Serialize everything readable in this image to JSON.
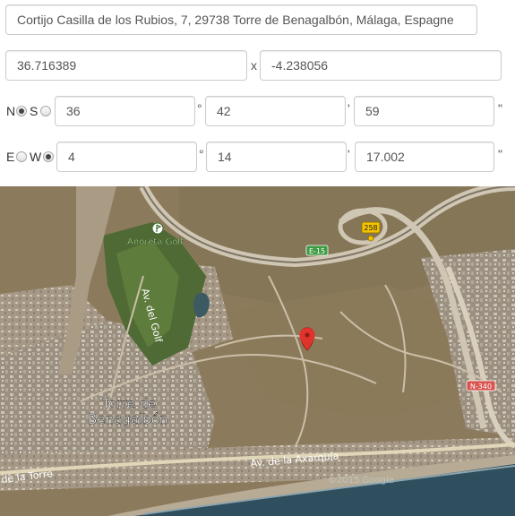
{
  "address": {
    "value": "Cortijo Casilla de los Rubios, 7, 29738 Torre de Benagalbón, Málaga, Espagne"
  },
  "decimal": {
    "lat": "36.716389",
    "separator": "x",
    "lng": "-4.238056"
  },
  "lat_dms": {
    "n_label": "N",
    "s_label": "S",
    "selected": "N",
    "deg": "36",
    "deg_sym": "°",
    "min": "42",
    "min_sym": "'",
    "sec": "59",
    "sec_sym": "\""
  },
  "lng_dms": {
    "e_label": "E",
    "w_label": "W",
    "selected": "W",
    "deg": "4",
    "deg_sym": "°",
    "min": "14",
    "min_sym": "'",
    "sec": "17.002",
    "sec_sym": "\""
  },
  "map": {
    "labels": {
      "golf": "Añoreta Golf",
      "road_e15": "E-15",
      "road_258": "258",
      "road_n340": "N-340",
      "av_golf": "Av. del Golf",
      "town_line1": "Torre de",
      "town_line2": "Benagalbón",
      "av_axarquia": "Av. de la Axarquía",
      "av_torre": "de la Torre",
      "copyright": "©2015 Google"
    },
    "colors": {
      "terrain": "#8c7a5c",
      "sea": "#2f4e5e",
      "marker": "#e0332b",
      "highway_shield": "#f2c200",
      "n_road_shield": "#d9534f"
    }
  }
}
